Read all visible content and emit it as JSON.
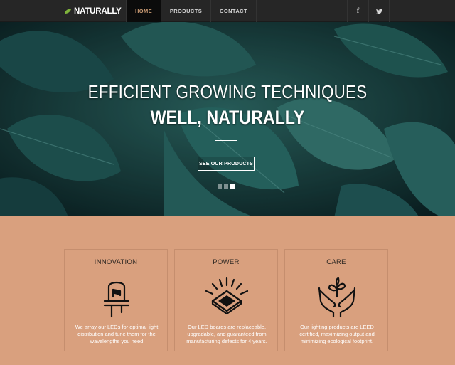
{
  "navbar": {
    "brand": "NATURALLY",
    "brand_icon": "leaf-icon",
    "items": [
      {
        "label": "HOME",
        "active": true
      },
      {
        "label": "PRODUCTS"
      },
      {
        "label": "CONTACT"
      }
    ],
    "social": [
      {
        "icon": "facebook-icon",
        "glyph": "f"
      },
      {
        "icon": "twitter-icon",
        "glyph": "🐦"
      }
    ]
  },
  "hero": {
    "title_line1": "EFFICIENT GROWING TECHNIQUES",
    "title_line2": "WELL, NATURALLY",
    "button_label": "SEE OUR PRODUCTS",
    "slides": 3,
    "active_slide": 3
  },
  "features": [
    {
      "title": "INNOVATION",
      "icon": "led-bulb-icon",
      "text": "We array our LEDs for optimal light distribution and tune them for the wavelengths you need"
    },
    {
      "title": "POWER",
      "icon": "led-chip-icon",
      "text": "Our LED boards are replaceable, upgradable, and guaranteed from manufacturing defects for 4 years."
    },
    {
      "title": "CARE",
      "icon": "hands-plant-icon",
      "text": "Our lighting products are LEED certified, maximizing output and minimizing ecological footprint."
    }
  ],
  "colors": {
    "navbar": "#262626",
    "accent": "#c99a73",
    "features_bg": "#d9a07e",
    "leaf_brand": "#7fb33b"
  }
}
